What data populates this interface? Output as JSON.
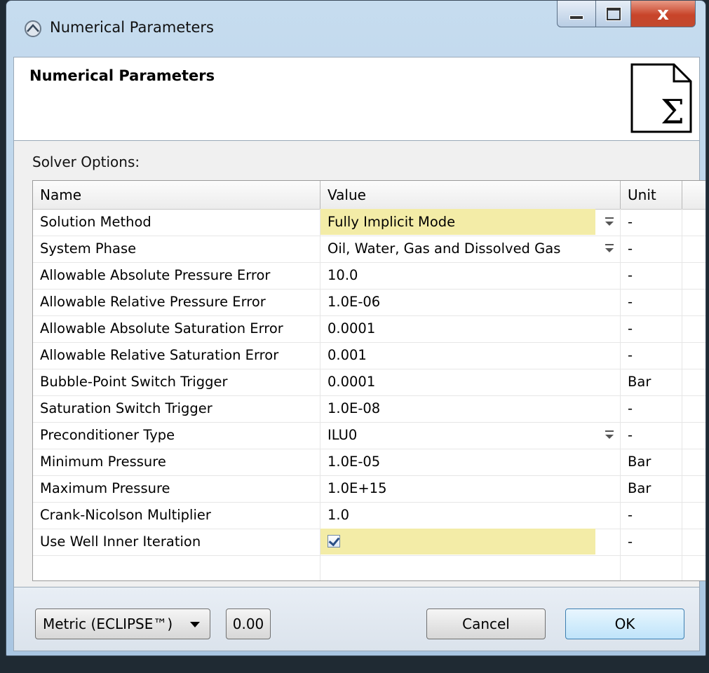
{
  "window": {
    "title": "Numerical Parameters",
    "close_glyph": "x"
  },
  "header": {
    "title": "Numerical Parameters",
    "icon_glyph": "Σ"
  },
  "section_label": "Solver Options:",
  "grid": {
    "columns": {
      "name": "Name",
      "value": "Value",
      "unit": "Unit"
    },
    "rows": [
      {
        "name": "Solution Method",
        "value": "Fully Implicit Mode",
        "unit": "-"
      },
      {
        "name": "System Phase",
        "value": "Oil, Water, Gas and Dissolved Gas",
        "unit": "-"
      },
      {
        "name": "Allowable Absolute Pressure Error",
        "value": "10.0",
        "unit": "-"
      },
      {
        "name": "Allowable Relative Pressure Error",
        "value": "1.0E-06",
        "unit": "-"
      },
      {
        "name": "Allowable Absolute Saturation Error",
        "value": "0.0001",
        "unit": "-"
      },
      {
        "name": "Allowable Relative Saturation Error",
        "value": "0.001",
        "unit": "-"
      },
      {
        "name": "Bubble-Point Switch Trigger",
        "value": "0.0001",
        "unit": "Bar"
      },
      {
        "name": "Saturation Switch Trigger",
        "value": "1.0E-08",
        "unit": "-"
      },
      {
        "name": "Preconditioner Type",
        "value": "ILU0",
        "unit": "-"
      },
      {
        "name": "Minimum Pressure",
        "value": "1.0E-05",
        "unit": "Bar"
      },
      {
        "name": "Maximum Pressure",
        "value": "1.0E+15",
        "unit": "Bar"
      },
      {
        "name": "Crank-Nicolson Multiplier",
        "value": "1.0",
        "unit": "-"
      },
      {
        "name": "Use Well Inner Iteration",
        "value": "",
        "unit": "-"
      }
    ]
  },
  "footer": {
    "units_label": "Metric (ECLIPSE™)",
    "precision_label": "0.00",
    "cancel_label": "Cancel",
    "ok_label": "OK"
  },
  "colors": {
    "highlight": "#f3eca7",
    "ok_button": "#bfe3fa",
    "close_button": "#c8442a"
  }
}
